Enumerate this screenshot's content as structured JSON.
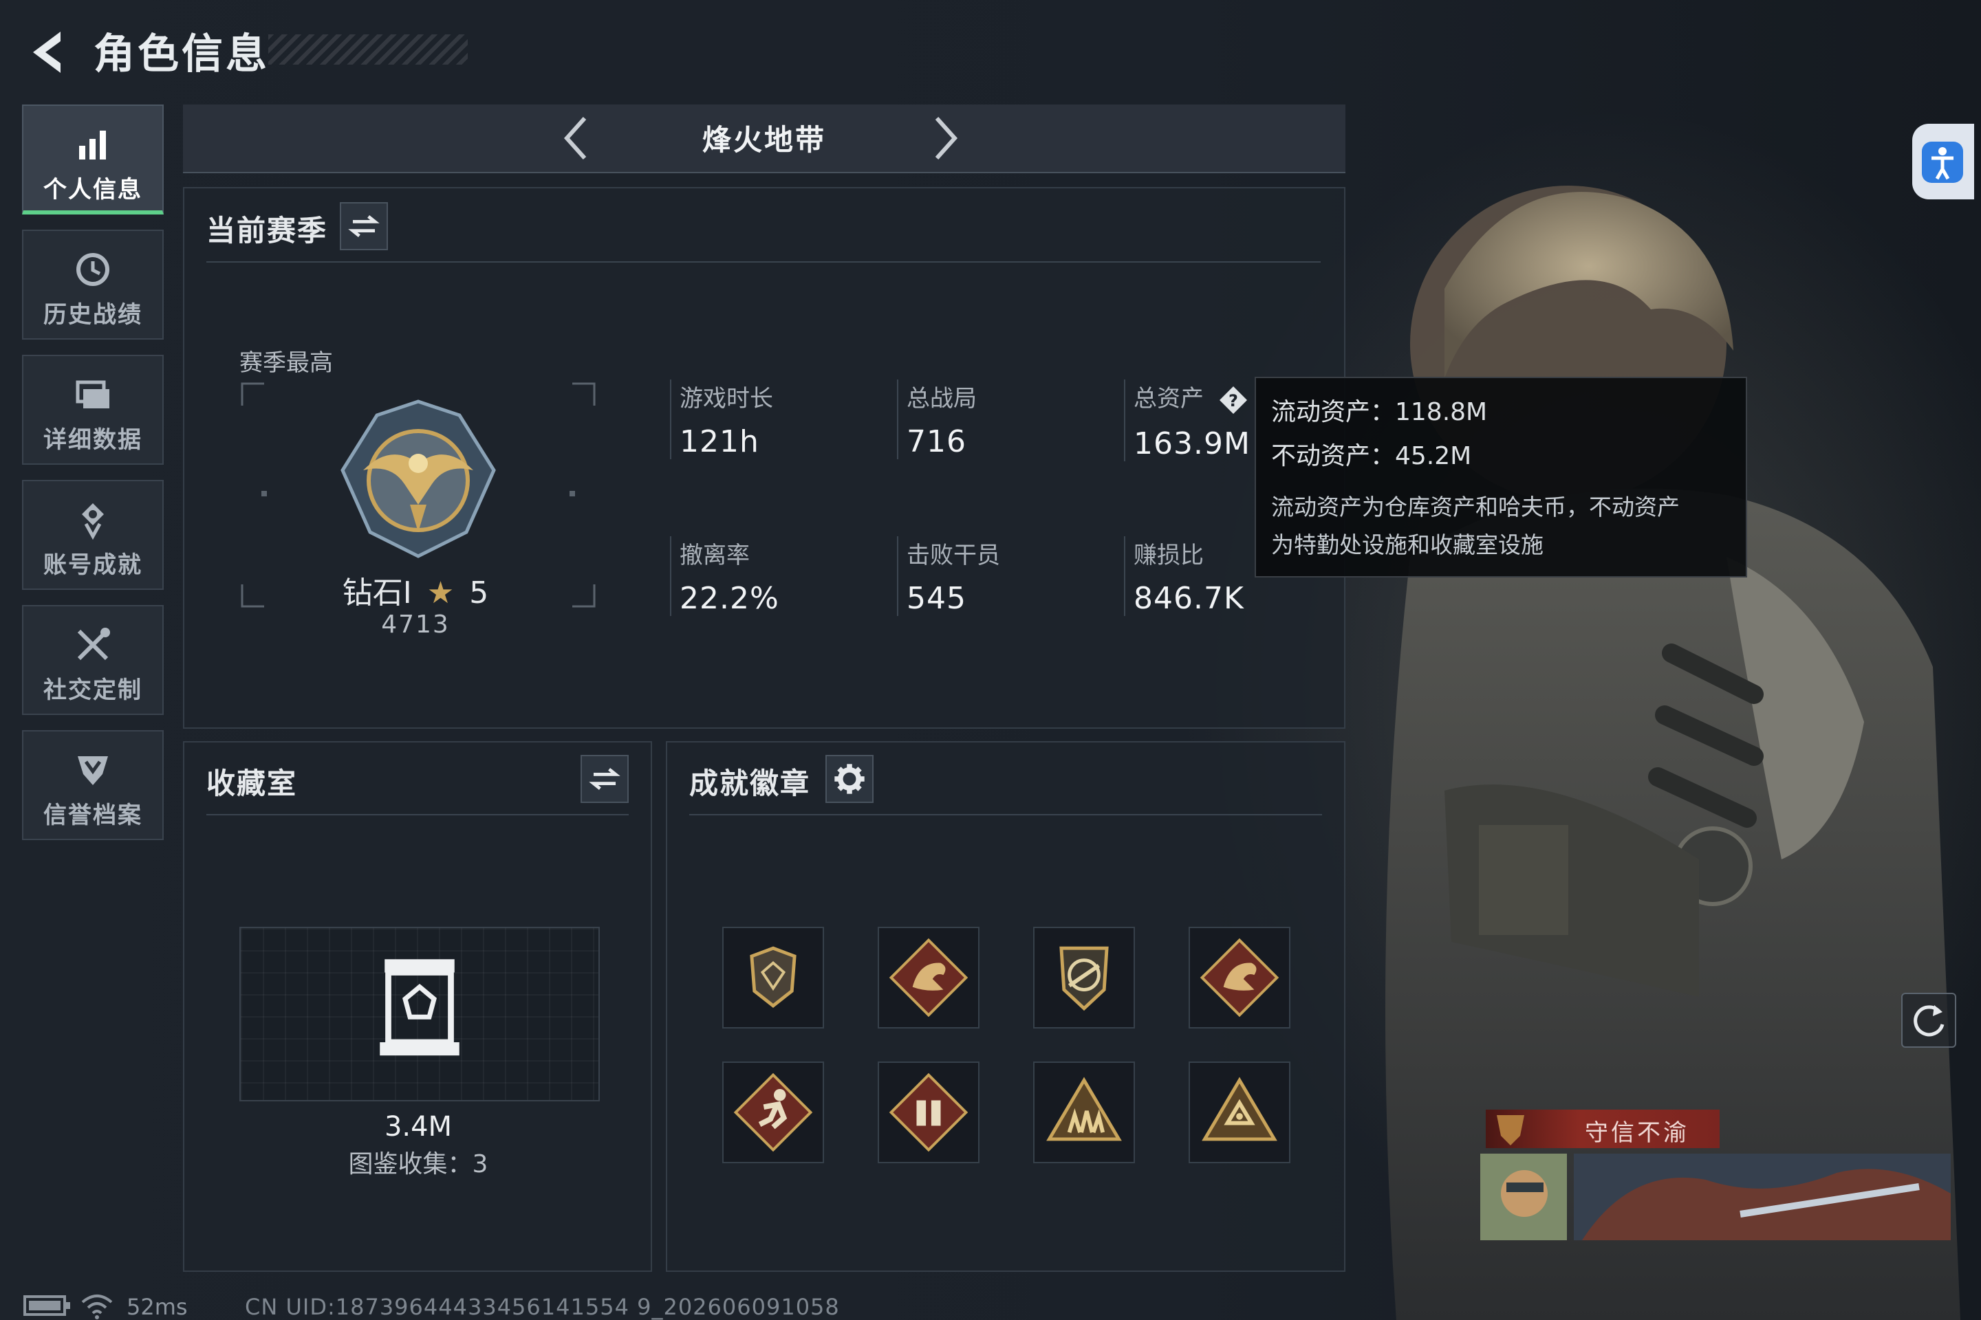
{
  "header": {
    "title": "角色信息",
    "back_icon": "back-arrow-icon"
  },
  "sidebar": {
    "items": [
      {
        "label": "个人信息",
        "icon": "bar-chart-icon",
        "active": true
      },
      {
        "label": "历史战绩",
        "icon": "history-clock-icon",
        "active": false
      },
      {
        "label": "详细数据",
        "icon": "folder-stack-icon",
        "active": false
      },
      {
        "label": "账号成就",
        "icon": "achievement-icon",
        "active": false
      },
      {
        "label": "社交定制",
        "icon": "tools-cross-icon",
        "active": false
      },
      {
        "label": "信誉档案",
        "icon": "shield-chevron-icon",
        "active": false
      }
    ]
  },
  "mode": {
    "title": "烽火地带"
  },
  "season": {
    "title": "当前赛季",
    "best_label": "赛季最高",
    "rank_name": "钻石I",
    "rank_stars": "5",
    "rank_score": "4713",
    "stats": [
      {
        "label": "游戏时长",
        "value": "121h"
      },
      {
        "label": "总战局",
        "value": "716"
      },
      {
        "label": "总资产",
        "value": "163.9M"
      },
      {
        "label": "撤离率",
        "value": "22.2%"
      },
      {
        "label": "击败干员",
        "value": "545"
      },
      {
        "label": "赚损比",
        "value": "846.7K"
      }
    ]
  },
  "tooltip": {
    "liquid": "流动资产：118.8M",
    "fixed": "不动资产：45.2M",
    "desc_line1": "流动资产为仓库资产和哈夫币，不动资产",
    "desc_line2": "为特勤处设施和收藏室设施"
  },
  "collection": {
    "title": "收藏室",
    "value": "3.4M",
    "count": "图鉴收集：3"
  },
  "badges": {
    "title": "成就徽章",
    "items": [
      "diamond-shield-badge-icon",
      "dragon-diamond-badge-icon",
      "rifle-shield-badge-icon",
      "dragon-diamond-badge-icon",
      "runner-diamond-badge-icon",
      "supply-diamond-badge-icon",
      "squad-triangle-badge-icon",
      "eye-triangle-badge-icon"
    ]
  },
  "profile": {
    "honor_title": "守信不渝"
  },
  "status": {
    "ping": "52ms",
    "uid": "CN UID:18739644433456141554 9_202606091058"
  },
  "colors": {
    "accent_green": "#5ed08a",
    "honor_red": "#8a2a22",
    "gold": "#c9a45a"
  }
}
